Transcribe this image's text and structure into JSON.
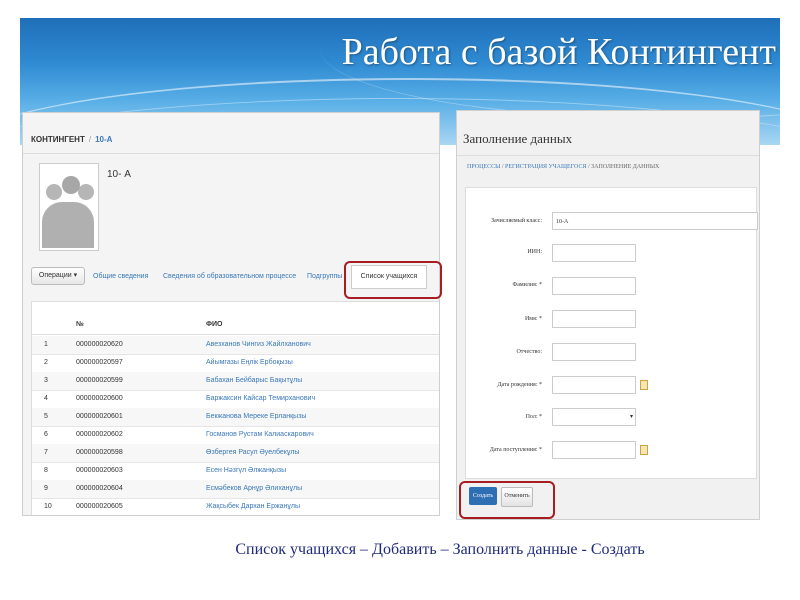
{
  "slide_title": "Работа с базой Контингент",
  "left": {
    "breadcrumb_root": "КОНТИНГЕНТ",
    "breadcrumb_sep": "/",
    "breadcrumb_current": "10-А",
    "class_name": "10- А",
    "operations_button": "Операции ▾",
    "tabs": [
      "Общие сведения",
      "Сведения об образовательном процессе",
      "Подгруппы"
    ],
    "active_tab": "Список учащихся",
    "table": {
      "headers": [
        "№",
        "",
        "ФИО"
      ],
      "rows": [
        [
          "1",
          "000000020620",
          "Авезханов Чингиз Жайлханович"
        ],
        [
          "2",
          "000000020597",
          "Айымгазы Еңлік Ербоқызы"
        ],
        [
          "3",
          "000000020599",
          "Бабахан Бейбарыс Бақытұлы"
        ],
        [
          "4",
          "000000020600",
          "Баржаксин Кайсар Темирханович"
        ],
        [
          "5",
          "000000020601",
          "Бекжанова Мереке Ерланқызы"
        ],
        [
          "6",
          "000000020602",
          "Госманов Рустам Калиаскарович"
        ],
        [
          "7",
          "000000020598",
          "Өзбергея Расул Әуелбекұлы"
        ],
        [
          "8",
          "000000020603",
          "Есен Нәзгүл Әлжанқызы"
        ],
        [
          "9",
          "000000020604",
          "Есмәбеков Арнұр Әлиханұлы"
        ],
        [
          "10",
          "000000020605",
          "Жақсыбек Дархан Ержанұлы"
        ]
      ]
    }
  },
  "right": {
    "form_title": "Заполнение данных",
    "crumb_1": "ПРОЦЕССЫ",
    "crumb_2": "РЕГИСТРАЦИЯ УЧАЩЕГОСЯ",
    "crumb_3": "ЗАПОЛНЕНИЕ ДАННЫХ",
    "crumb_sep": "/",
    "fields": {
      "class_label": "Зачисляемый класс:",
      "class_value": "10-А",
      "iin_label": "ИИН:",
      "surname_label": "Фамилия: *",
      "name_label": "Имя: *",
      "patronymic_label": "Отчество:",
      "birthdate_label": "Дата рождения: *",
      "gender_label": "Пол: *",
      "admission_label": "Дата поступления: *"
    },
    "create_button": "Создать",
    "cancel_button": "Отменить"
  },
  "caption": "Список учащихся – Добавить – Заполнить данные - Создать",
  "colors": {
    "accent_red": "#a61e22",
    "link_blue": "#3a78b9",
    "button_blue": "#2e6fb3",
    "caption_blue": "#1f2a7a"
  }
}
